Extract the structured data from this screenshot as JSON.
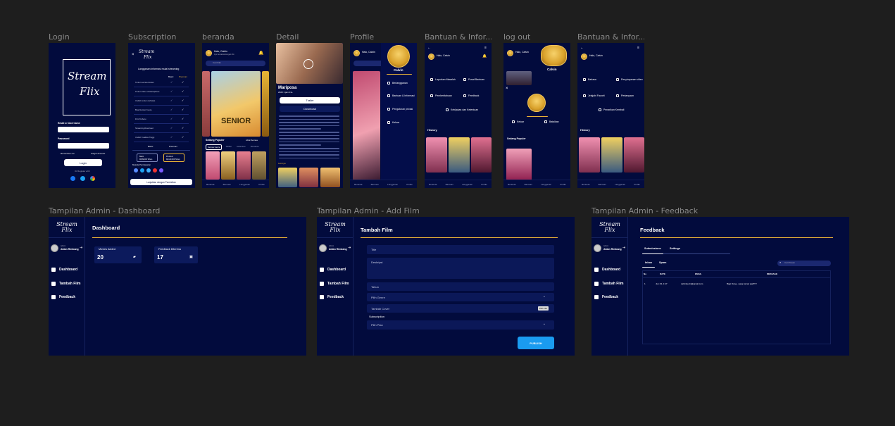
{
  "labels": {
    "login": "Login",
    "subscription": "Subscription",
    "beranda": "beranda",
    "detail": "Detail",
    "profile": "Profile",
    "bantuan1": "Bantuan & Infor...",
    "logout": "log out",
    "bantuan2": "Bantuan & Infor...",
    "admin_dashboard": "Tampilan Admin - Dashboard",
    "admin_add": "Tampilan Admin - Add Film",
    "admin_feedback": "Tampilan Admin - Feedback"
  },
  "brand": {
    "line1": "Stream",
    "line2": "Flix",
    "accent": "#e8b536",
    "bg": "#020b3d"
  },
  "login": {
    "email_label": "Email or Username",
    "password_label": "Password",
    "remember": "Remember me",
    "forgot": "Forgot Account",
    "button": "Login",
    "or": "Or Register with"
  },
  "subscription": {
    "title": "Langganan informasi mulai streaming",
    "col_basic": "Basic",
    "col_premium": "Premium",
    "rows": [
      "Tonton semua konten",
      "Tonton Video di Handphone",
      "Unduh konten terbatas",
      "Bisa Nonton Kuota",
      "Film Terbaru",
      "Streaming/download",
      "Unduh Kualitas Tinggi"
    ],
    "opt1": "Basic",
    "opt2": "Premium",
    "price1": "Rp59,000 Tahun",
    "price2": "Rp129,000 Tahun",
    "payment": "Metode Pembayaran",
    "continue": "Lanjutkan dengan Pembelian"
  },
  "beranda": {
    "greeting": "Halo, Calvin",
    "sub": "Ayo bersantai dengan film",
    "search": "Cari Film",
    "banner_title": "SENIOR",
    "section": "Sedang Populer",
    "see_all": "Lihat Semua",
    "chips": [
      "Semua Genre",
      "Thriller",
      "Adventure",
      "Romance"
    ]
  },
  "detail": {
    "title": "Mariposa",
    "meta": "2020   1 jam   13+",
    "trailer": "Trailer",
    "download": "Download",
    "lainnya": "Lainnya"
  },
  "profile": {
    "name": "Calvin",
    "items": [
      "Berlangganan",
      "Bantuan & Informasi",
      "Pengaturan privasi",
      "Keluar"
    ]
  },
  "bantuan": {
    "items": [
      "Laporkan Masalah",
      "Pusat Bantuan",
      "Pemberitahuan",
      "Feedback",
      "Kebijakan dan Ketentuan"
    ],
    "history": "History"
  },
  "logout": {
    "cancel": "Keluar",
    "confirm": "Batalkan"
  },
  "bantuan2": {
    "items": [
      "Bahasa",
      "Penyimpanan video",
      "Jelajahi Favorit",
      "Pertanyaan",
      "Penarikan Kembali"
    ],
    "history": "History"
  },
  "admin": {
    "user": "Aldan Rimbang",
    "user_role": "Admin",
    "nav": [
      "Dashboard",
      "Tambah Film",
      "Feedback"
    ],
    "dashboard": {
      "title": "Dashboard",
      "cards": [
        {
          "label": "Movies Added",
          "value": "20"
        },
        {
          "label": "Feedback Diterima",
          "value": "17"
        }
      ]
    },
    "add": {
      "title": "Tambah Film",
      "fields": [
        "Title",
        "Deskripsi",
        "Tahun",
        "Pilih Genre",
        "Tambah Cover",
        "Subscription",
        "Pilih Plan"
      ],
      "file_btn": "Pilih File",
      "publish": "PUBLISH"
    },
    "feedback": {
      "title": "Feedback",
      "tabs": [
        "Submissions",
        "Settings"
      ],
      "subtabs": [
        "Inbox",
        "Spam"
      ],
      "search": "Cari Pesan",
      "columns": [
        "No",
        "DATE",
        "EMAIL",
        "MESSAGE"
      ],
      "rows": [
        {
          "no": "1",
          "date": "Jun 23, 1:47",
          "email": "calvinkevin@gmail.com",
          "message": "Bagi Dong.. yang kamar ajal!!!!!!"
        }
      ]
    }
  }
}
